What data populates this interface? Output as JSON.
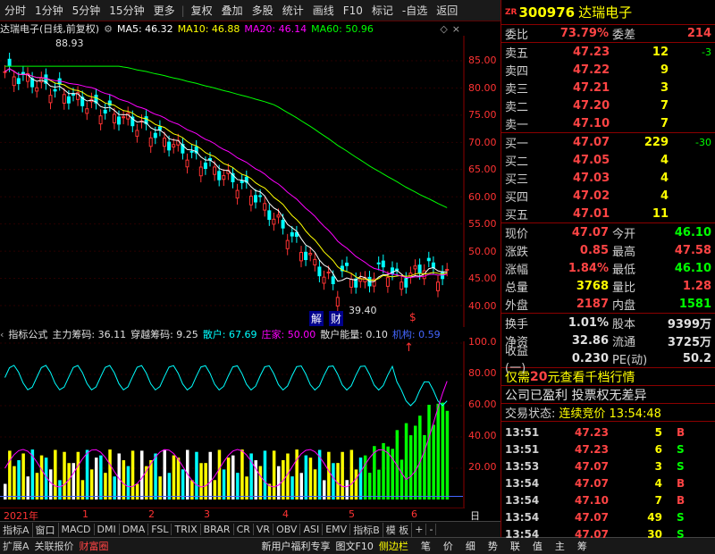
{
  "toolbar": {
    "items": [
      "分时",
      "1分钟",
      "5分钟",
      "15分钟",
      "更多",
      "复权",
      "叠加",
      "多股",
      "统计",
      "画线",
      "F10",
      "标记",
      "-自选",
      "返回"
    ]
  },
  "chart_title": {
    "name": "达瑞电子(日线,前复权)",
    "ma5": "MA5: 46.32",
    "ma10": "MA10: 46.88",
    "ma20": "MA20: 46.14",
    "ma60": "MA60: 50.96",
    "high_mark": "88.93",
    "low_mark": "39.40",
    "jie": "解",
    "cai": "财",
    "s_mark": "$"
  },
  "colors": {
    "ma5": "#ffffff",
    "ma10": "#ffff00",
    "ma20": "#ff00ff",
    "ma60": "#00ff00",
    "up": "#ff3333",
    "down": "#00ffff"
  },
  "price_axis": [
    "85.00",
    "80.00",
    "75.00",
    "70.00",
    "65.00",
    "60.00",
    "55.00",
    "50.00",
    "45.00",
    "40.00"
  ],
  "indicator": {
    "name": "指标公式",
    "zlcm": "主力筹码: 36.11",
    "cycm": "穿越筹码: 9.25",
    "sanhu": "散户: 67.69",
    "zhuangjia": "庄家: 50.00",
    "shnl": "散户能量: 0.10",
    "jigou": "机构: 0.59"
  },
  "ind_axis": [
    "100.0",
    "80.00",
    "60.00",
    "40.00",
    "20.00"
  ],
  "dates": {
    "year": "2021年",
    "m1": "1",
    "m2": "2",
    "m3": "3",
    "m4": "4",
    "m5": "5",
    "m6": "6",
    "period": "日线"
  },
  "tabs": [
    "指标A",
    "窗口",
    "MACD",
    "DMI",
    "DMA",
    "FSL",
    "TRIX",
    "BRAR",
    "CR",
    "VR",
    "OBV",
    "ASI",
    "EMV",
    "指标B",
    "模 板",
    "+",
    "-"
  ],
  "bottom": {
    "left": [
      "扩展A",
      "关联报价",
      "财富圈"
    ],
    "mid": [
      "新用户福利专享",
      "图文F10",
      "侧边栏"
    ],
    "right": [
      "笔",
      "价",
      "细",
      "势",
      "联",
      "值",
      "主",
      "筹"
    ]
  },
  "stock": {
    "zr": "ZR",
    "code": "300976",
    "name": "达瑞电子"
  },
  "weibi": {
    "label1": "委比",
    "v1": "73.79%",
    "label2": "委差",
    "v2": "214"
  },
  "asks": [
    {
      "label": "卖五",
      "price": "47.23",
      "vol": "12",
      "chg": "-3"
    },
    {
      "label": "卖四",
      "price": "47.22",
      "vol": "9",
      "chg": ""
    },
    {
      "label": "卖三",
      "price": "47.21",
      "vol": "3",
      "chg": ""
    },
    {
      "label": "卖二",
      "price": "47.20",
      "vol": "7",
      "chg": ""
    },
    {
      "label": "卖一",
      "price": "47.10",
      "vol": "7",
      "chg": ""
    }
  ],
  "bids": [
    {
      "label": "买一",
      "price": "47.07",
      "vol": "229",
      "chg": "-30"
    },
    {
      "label": "买二",
      "price": "47.05",
      "vol": "4",
      "chg": ""
    },
    {
      "label": "买三",
      "price": "47.03",
      "vol": "4",
      "chg": ""
    },
    {
      "label": "买四",
      "price": "47.02",
      "vol": "4",
      "chg": ""
    },
    {
      "label": "买五",
      "price": "47.01",
      "vol": "11",
      "chg": ""
    }
  ],
  "quote": [
    {
      "l1": "现价",
      "v1": "47.07",
      "c1": "#ff4444",
      "l2": "今开",
      "v2": "46.10",
      "c2": "#00ff00"
    },
    {
      "l1": "涨跌",
      "v1": "0.85",
      "c1": "#ff4444",
      "l2": "最高",
      "v2": "47.58",
      "c2": "#ff4444"
    },
    {
      "l1": "涨幅",
      "v1": "1.84%",
      "c1": "#ff4444",
      "l2": "最低",
      "v2": "46.10",
      "c2": "#00ff00"
    },
    {
      "l1": "总量",
      "v1": "3768",
      "c1": "#ffff00",
      "l2": "量比",
      "v2": "1.28",
      "c2": "#ff4444"
    },
    {
      "l1": "外盘",
      "v1": "2187",
      "c1": "#ff4444",
      "l2": "内盘",
      "v2": "1581",
      "c2": "#00ff00"
    }
  ],
  "quote2": [
    {
      "l1": "换手",
      "v1": "1.01%",
      "c1": "#e0e0e0",
      "l2": "股本",
      "v2": "9399万",
      "c2": "#e0e0e0"
    },
    {
      "l1": "净资",
      "v1": "32.86",
      "c1": "#e0e0e0",
      "l2": "流通",
      "v2": "3725万",
      "c2": "#e0e0e0"
    },
    {
      "l1": "收益(一)",
      "v1": "0.230",
      "c1": "#e0e0e0",
      "l2": "PE(动)",
      "v2": "50.2",
      "c2": "#e0e0e0"
    }
  ],
  "promo1": {
    "a": "仅需",
    "b": "20",
    "c": "元查看千档行情"
  },
  "promo2": "公司已盈利 投票权无差异",
  "status": {
    "label": "交易状态:",
    "value": "连续竞价 13:54:48"
  },
  "ticks": [
    {
      "t": "13:51",
      "p": "47.23",
      "v": "5",
      "bs": "B"
    },
    {
      "t": "13:51",
      "p": "47.23",
      "v": "6",
      "bs": "S"
    },
    {
      "t": "13:53",
      "p": "47.07",
      "v": "3",
      "bs": "S"
    },
    {
      "t": "13:54",
      "p": "47.07",
      "v": "4",
      "bs": "B"
    },
    {
      "t": "13:54",
      "p": "47.10",
      "v": "7",
      "bs": "B"
    },
    {
      "t": "13:54",
      "p": "47.07",
      "v": "49",
      "bs": "S"
    },
    {
      "t": "13:54",
      "p": "47.07",
      "v": "30",
      "bs": "S"
    }
  ]
}
